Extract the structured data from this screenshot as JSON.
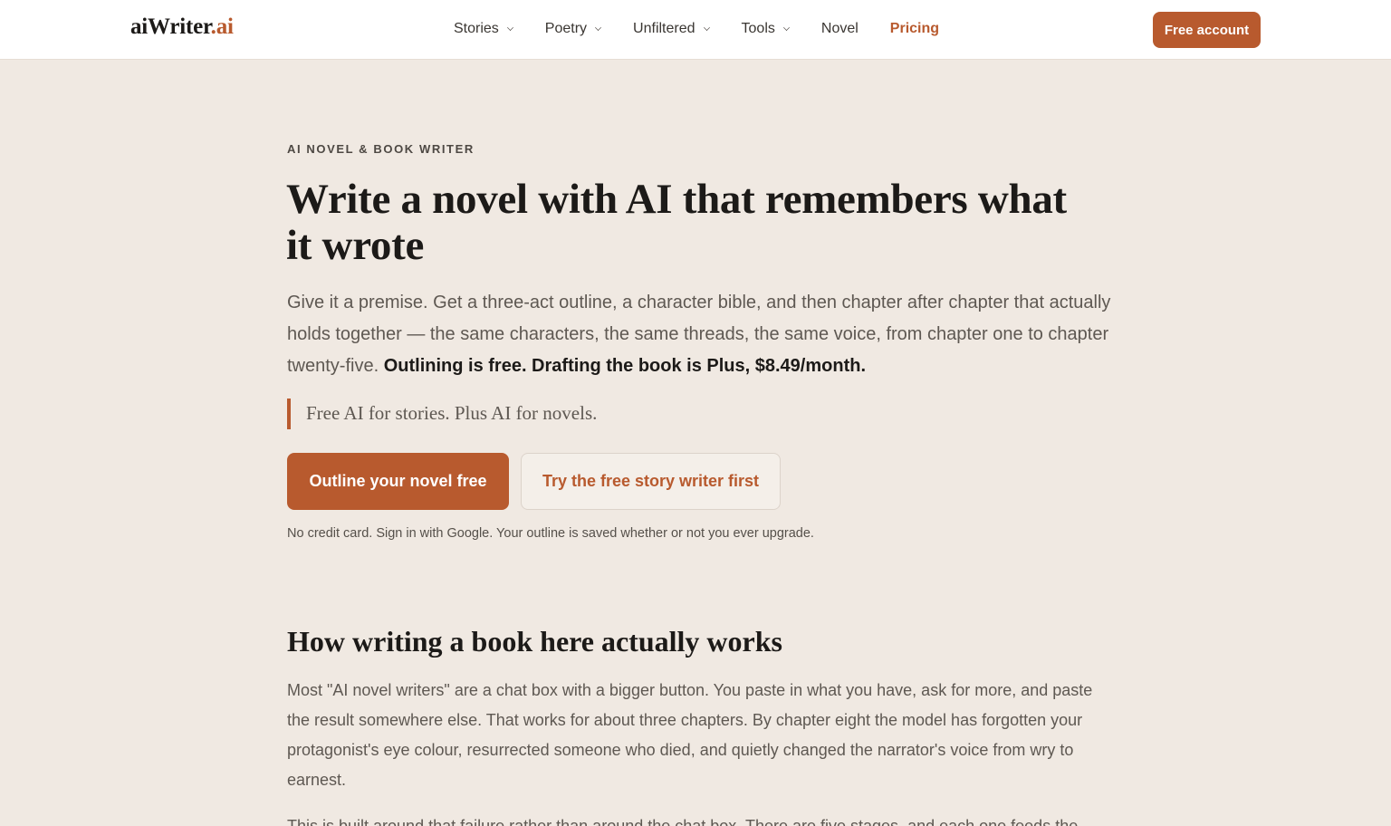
{
  "header": {
    "logo_main": "aiWriter",
    "logo_tld": ".ai",
    "nav": [
      {
        "label": "Stories",
        "dropdown": true
      },
      {
        "label": "Poetry",
        "dropdown": true
      },
      {
        "label": "Unfiltered",
        "dropdown": true
      },
      {
        "label": "Tools",
        "dropdown": true
      },
      {
        "label": "Novel",
        "dropdown": false
      },
      {
        "label": "Pricing",
        "dropdown": false,
        "accent": true
      }
    ],
    "cta_label": "Free account"
  },
  "hero": {
    "kicker": "AI NOVEL & BOOK WRITER",
    "title": "Write a novel with AI that remembers what it wrote",
    "lede_text": "Give it a premise. Get a three-act outline, a character bible, and then chapter after chapter that actually holds together — the same characters, the same threads, the same voice, from chapter one to chapter twenty-five. ",
    "lede_strong": "Outlining is free. Drafting the book is Plus, $8.49/month.",
    "tagline": "Free AI for stories. Plus AI for novels.",
    "primary_button": "Outline your novel free",
    "secondary_button": "Try the free story writer first",
    "fineprint": "No credit card. Sign in with Google. Your outline is saved whether or not you ever upgrade."
  },
  "section": {
    "title": "How writing a book here actually works",
    "paragraph_1": "Most \"AI novel writers\" are a chat box with a bigger button. You paste in what you have, ask for more, and paste the result somewhere else. That works for about three chapters. By chapter eight the model has forgotten your protagonist's eye colour, resurrected someone who died, and quietly changed the narrator's voice from wry to earnest.",
    "paragraph_2": "This is built around that failure rather than around the chat box. There are five stages, and each one feeds the"
  },
  "colors": {
    "accent": "#b85a2e",
    "background": "#f0e9e2",
    "header_bg": "#ffffff",
    "text_dark": "#1c1a18",
    "text_muted": "#5e5852"
  }
}
